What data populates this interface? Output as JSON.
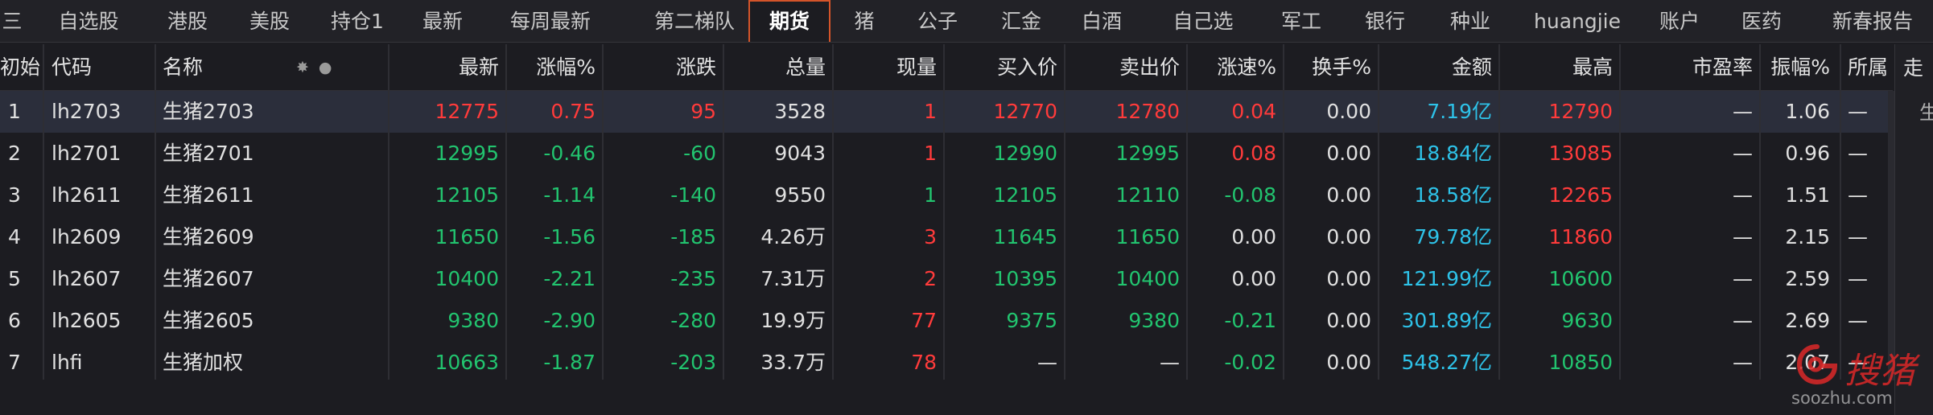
{
  "tabs": [
    {
      "label": "三",
      "active": false
    },
    {
      "label": "自选股",
      "active": false
    },
    {
      "label": "港股",
      "active": false
    },
    {
      "label": "美股",
      "active": false
    },
    {
      "label": "持仓1",
      "active": false
    },
    {
      "label": "最新",
      "active": false
    },
    {
      "label": "每周最新",
      "active": false
    },
    {
      "label": "第二梯队",
      "active": false
    },
    {
      "label": "期货",
      "active": true
    },
    {
      "label": "猪",
      "active": false
    },
    {
      "label": "公子",
      "active": false
    },
    {
      "label": "汇金",
      "active": false
    },
    {
      "label": "白酒",
      "active": false
    },
    {
      "label": "自己选",
      "active": false
    },
    {
      "label": "军工",
      "active": false
    },
    {
      "label": "银行",
      "active": false
    },
    {
      "label": "种业",
      "active": false
    },
    {
      "label": "huangjie",
      "active": false
    },
    {
      "label": "账户",
      "active": false
    },
    {
      "label": "医药",
      "active": false
    },
    {
      "label": "新春报告",
      "active": false
    }
  ],
  "table": {
    "header_icons": [
      "✸",
      "●"
    ],
    "columns": [
      {
        "key": "init",
        "label": "初始"
      },
      {
        "key": "code",
        "label": "代码"
      },
      {
        "key": "name",
        "label": "名称"
      },
      {
        "key": "latest",
        "label": "最新"
      },
      {
        "key": "pct",
        "label": "涨幅%"
      },
      {
        "key": "change",
        "label": "涨跌"
      },
      {
        "key": "volume",
        "label": "总量"
      },
      {
        "key": "current",
        "label": "现量"
      },
      {
        "key": "bid",
        "label": "买入价"
      },
      {
        "key": "ask",
        "label": "卖出价"
      },
      {
        "key": "speed",
        "label": "涨速%"
      },
      {
        "key": "turnover",
        "label": "换手%"
      },
      {
        "key": "amount",
        "label": "金额"
      },
      {
        "key": "high",
        "label": "最高"
      },
      {
        "key": "pe",
        "label": "市盈率"
      },
      {
        "key": "amplitude",
        "label": "振幅%"
      },
      {
        "key": "belong",
        "label": "所属"
      }
    ],
    "rows": [
      {
        "init": "1",
        "code": "lh2703",
        "name": "生猪2703",
        "latest": "12775",
        "pct": "0.75",
        "change": "95",
        "volume": "3528",
        "current": "1",
        "bid": "12770",
        "ask": "12780",
        "speed": "0.04",
        "turnover": "0.00",
        "amount": "7.19亿",
        "high": "12790",
        "pe": "—",
        "amplitude": "1.06",
        "belong": "—",
        "colors": {
          "latest": "up",
          "pct": "up",
          "change": "up",
          "current": "up",
          "bid": "up",
          "ask": "up",
          "speed": "up",
          "high": "up"
        }
      },
      {
        "init": "2",
        "code": "lh2701",
        "name": "生猪2701",
        "latest": "12995",
        "pct": "-0.46",
        "change": "-60",
        "volume": "9043",
        "current": "1",
        "bid": "12990",
        "ask": "12995",
        "speed": "0.08",
        "turnover": "0.00",
        "amount": "18.84亿",
        "high": "13085",
        "pe": "—",
        "amplitude": "0.96",
        "belong": "—",
        "colors": {
          "latest": "down",
          "pct": "down",
          "change": "down",
          "current": "up",
          "bid": "down",
          "ask": "down",
          "speed": "up",
          "high": "up"
        }
      },
      {
        "init": "3",
        "code": "lh2611",
        "name": "生猪2611",
        "latest": "12105",
        "pct": "-1.14",
        "change": "-140",
        "volume": "9550",
        "current": "1",
        "bid": "12105",
        "ask": "12110",
        "speed": "-0.08",
        "turnover": "0.00",
        "amount": "18.58亿",
        "high": "12265",
        "pe": "—",
        "amplitude": "1.51",
        "belong": "—",
        "colors": {
          "latest": "down",
          "pct": "down",
          "change": "down",
          "current": "down",
          "bid": "down",
          "ask": "down",
          "speed": "down",
          "high": "up"
        }
      },
      {
        "init": "4",
        "code": "lh2609",
        "name": "生猪2609",
        "latest": "11650",
        "pct": "-1.56",
        "change": "-185",
        "volume": "4.26万",
        "current": "3",
        "bid": "11645",
        "ask": "11650",
        "speed": "0.00",
        "turnover": "0.00",
        "amount": "79.78亿",
        "high": "11860",
        "pe": "—",
        "amplitude": "2.15",
        "belong": "—",
        "colors": {
          "latest": "down",
          "pct": "down",
          "change": "down",
          "current": "up",
          "bid": "down",
          "ask": "down",
          "speed": "flat",
          "high": "up"
        }
      },
      {
        "init": "5",
        "code": "lh2607",
        "name": "生猪2607",
        "latest": "10400",
        "pct": "-2.21",
        "change": "-235",
        "volume": "7.31万",
        "current": "2",
        "bid": "10395",
        "ask": "10400",
        "speed": "0.00",
        "turnover": "0.00",
        "amount": "121.99亿",
        "high": "10600",
        "pe": "—",
        "amplitude": "2.59",
        "belong": "—",
        "colors": {
          "latest": "down",
          "pct": "down",
          "change": "down",
          "current": "up",
          "bid": "down",
          "ask": "down",
          "speed": "flat",
          "high": "down"
        }
      },
      {
        "init": "6",
        "code": "lh2605",
        "name": "生猪2605",
        "latest": "9380",
        "pct": "-2.90",
        "change": "-280",
        "volume": "19.9万",
        "current": "77",
        "bid": "9375",
        "ask": "9380",
        "speed": "-0.21",
        "turnover": "0.00",
        "amount": "301.89亿",
        "high": "9630",
        "pe": "—",
        "amplitude": "2.69",
        "belong": "—",
        "colors": {
          "latest": "down",
          "pct": "down",
          "change": "down",
          "current": "up",
          "bid": "down",
          "ask": "down",
          "speed": "down",
          "high": "down"
        }
      },
      {
        "init": "7",
        "code": "lhfi",
        "name": "生猪加权",
        "latest": "10663",
        "pct": "-1.87",
        "change": "-203",
        "volume": "33.7万",
        "current": "78",
        "bid": "—",
        "ask": "—",
        "speed": "-0.02",
        "turnover": "0.00",
        "amount": "548.27亿",
        "high": "10850",
        "pe": "—",
        "amplitude": "2.07",
        "belong": "—",
        "colors": {
          "latest": "down",
          "pct": "down",
          "change": "down",
          "current": "up",
          "bid": "flat",
          "ask": "flat",
          "speed": "down",
          "high": "down"
        }
      }
    ]
  },
  "side_panel": {
    "title": "走",
    "sub": "生"
  },
  "watermark": {
    "text": "搜猪",
    "url": "soozhu.com"
  },
  "colors": {
    "up": "#ff3b3b",
    "down": "#22c46f",
    "amount": "#2ec2e8",
    "active_tab_border": "#d4542a"
  }
}
